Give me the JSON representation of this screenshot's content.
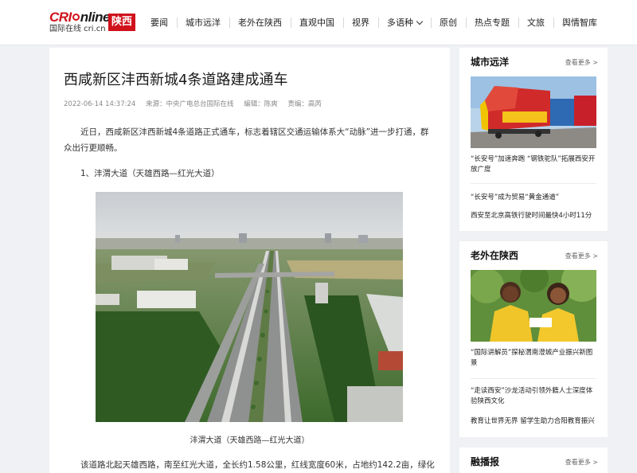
{
  "brand": {
    "logo_main_red": "CRI",
    "logo_main_rest": "nline",
    "logo_sub": "国际在线 cri.cn",
    "badge": "陕西"
  },
  "nav": {
    "items": [
      "要闻",
      "城市远洋",
      "老外在陕西",
      "直观中国",
      "视界",
      "多语种",
      "原创",
      "热点专题",
      "文旅",
      "舆情智库"
    ]
  },
  "article": {
    "title": "西咸新区沣西新城4条道路建成通车",
    "date": "2022-06-14 14:37:24",
    "source": "来源：中央广电总台国际在线",
    "editor": "编辑：陈爽",
    "reviewer": "责编：高芮",
    "para1": "近日，西咸新区沣西新城4条道路正式通车，标志着辖区交通运输体系大“动脉”进一步打通，群众出行更顺畅。",
    "para2": "1、沣渭大道（天雄西路—红光大道）",
    "caption": "沣渭大道（天雄西路—红光大道）",
    "para3": "该道路北起天雄西路，南至红光大道，全长约1.58公里，红线宽度60米，占地约142.2亩，绿化"
  },
  "sidebar": {
    "card1": {
      "title": "城市远洋",
      "more": "查看更多 >",
      "items": [
        "“长安号”加速奔跑 “钢铁驼队”拓展西安开放广度",
        "“长安号”成为贸易“黄金通道”",
        "西安至北京高铁行驶时间最快4小时11分"
      ]
    },
    "card2": {
      "title": "老外在陕西",
      "more": "查看更多 >",
      "items": [
        "“国际讲解员”探秘渭南澄城产业振兴新图景",
        "“走读西安”沙龙活动引领外籍人士深度体验陕西文化",
        "教育让世界无界 留学生助力合阳教育振兴"
      ]
    },
    "card3": {
      "title": "融播报",
      "more": "查看更多 >"
    }
  },
  "colors": {
    "brand_red": "#d0121b",
    "page_bg": "#eff1f4"
  }
}
